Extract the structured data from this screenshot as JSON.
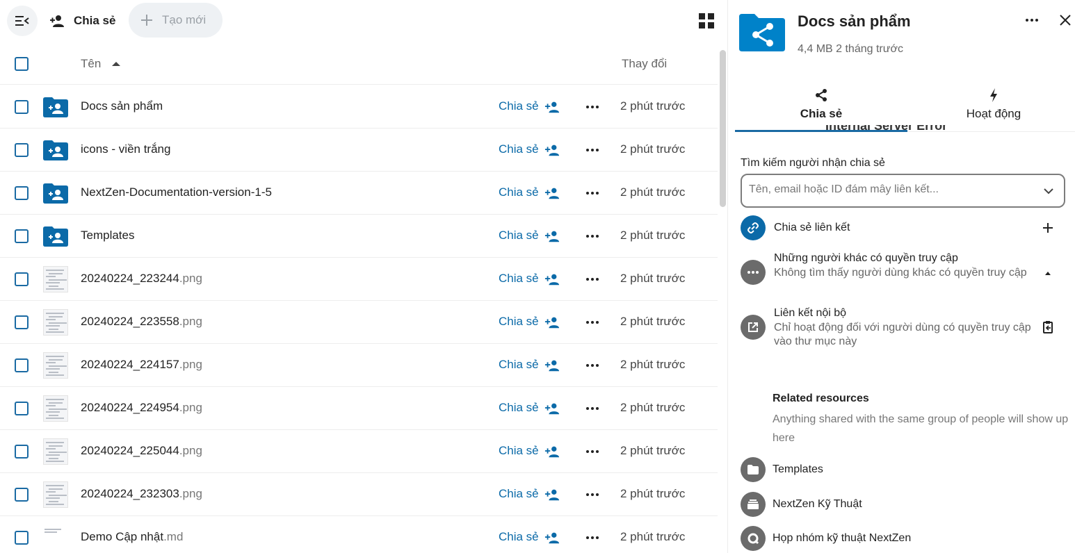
{
  "colors": {
    "accent": "#0b6aa8",
    "folder": "#0082c9",
    "dark_avatar": "#6b6b6b"
  },
  "toolbar": {
    "nav_toggle_icon": "menu-collapse-icon",
    "breadcrumb_label": "Chia sẻ",
    "new_label": "Tạo mới",
    "grid_icon": "grid-view-icon"
  },
  "header": {
    "name_col": "Tên",
    "modified_col": "Thay đổi"
  },
  "files": [
    {
      "name": "Docs sản phẩm",
      "ext": "",
      "type": "folder",
      "share": "Chia sẻ",
      "modified": "2 phút trước"
    },
    {
      "name": "icons - viền trắng",
      "ext": "",
      "type": "folder",
      "share": "Chia sẻ",
      "modified": "2 phút trước"
    },
    {
      "name": "NextZen-Documentation-version-1-5",
      "ext": "",
      "type": "folder",
      "share": "Chia sẻ",
      "modified": "2 phút trước"
    },
    {
      "name": "Templates",
      "ext": "",
      "type": "folder",
      "share": "Chia sẻ",
      "modified": "2 phút trước"
    },
    {
      "name": "20240224_223244",
      "ext": ".png",
      "type": "image",
      "share": "Chia sẻ",
      "modified": "2 phút trước"
    },
    {
      "name": "20240224_223558",
      "ext": ".png",
      "type": "image",
      "share": "Chia sẻ",
      "modified": "2 phút trước"
    },
    {
      "name": "20240224_224157",
      "ext": ".png",
      "type": "image",
      "share": "Chia sẻ",
      "modified": "2 phút trước"
    },
    {
      "name": "20240224_224954",
      "ext": ".png",
      "type": "image",
      "share": "Chia sẻ",
      "modified": "2 phút trước"
    },
    {
      "name": "20240224_225044",
      "ext": ".png",
      "type": "image",
      "share": "Chia sẻ",
      "modified": "2 phút trước"
    },
    {
      "name": "20240224_232303",
      "ext": ".png",
      "type": "image",
      "share": "Chia sẻ",
      "modified": "2 phút trước"
    },
    {
      "name": "Demo Cập nhật",
      "ext": ".md",
      "type": "text",
      "share": "Chia sẻ",
      "modified": "2 phút trước"
    }
  ],
  "sidebar": {
    "title": "Docs sản phẩm",
    "subtitle": "4,4 MB 2 tháng trước",
    "clipped_error": "Internal Server Error",
    "tabs": [
      {
        "label": "Chia sẻ",
        "icon": "share-icon"
      },
      {
        "label": "Hoạt động",
        "icon": "activity-icon"
      }
    ],
    "search_label": "Tìm kiếm người nhận chia sẻ",
    "search_placeholder": "Tên, email hoặc ID đám mây liên kết...",
    "entries": [
      {
        "title": "Chia sẻ liên kết",
        "desc": "",
        "icon": "link-icon",
        "action_icon": "plus-icon"
      },
      {
        "title": "Những người khác có quyền truy cập",
        "desc": "Không tìm thấy người dùng khác có quyền truy cập",
        "icon": "dots-icon",
        "action_icon": "triangle-up-icon"
      },
      {
        "title": "Liên kết nội bộ",
        "desc": "Chỉ hoạt động đối với người dùng có quyền truy cập vào thư mục này",
        "icon": "external-link-icon",
        "action_icon": "clipboard-icon"
      }
    ],
    "related_title": "Related resources",
    "related_desc": "Anything shared with the same group of people will show up here",
    "resources": [
      {
        "label": "Templates",
        "icon": "folder-icon"
      },
      {
        "label": "NextZen Kỹ Thuật",
        "icon": "deck-icon"
      },
      {
        "label": "Họp nhóm kỹ thuật NextZen",
        "icon": "talk-icon"
      }
    ]
  }
}
